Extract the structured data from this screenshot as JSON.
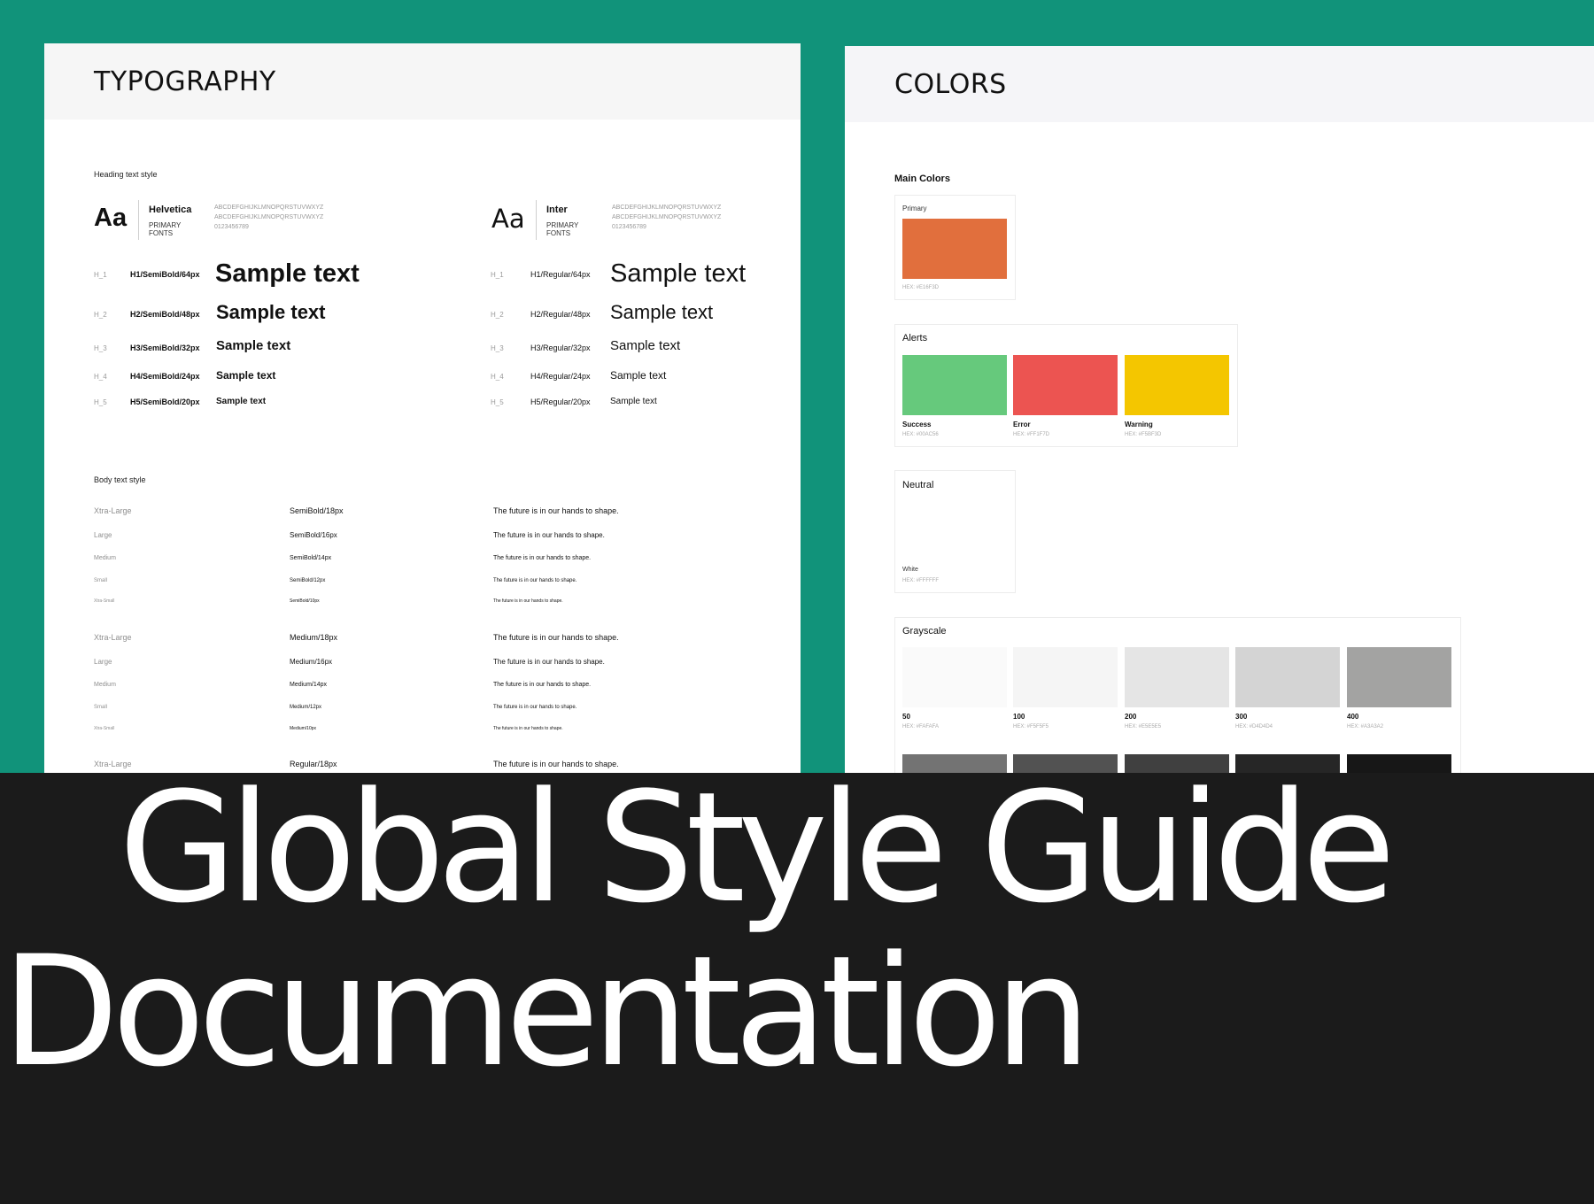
{
  "typography": {
    "title": "TYPOGRAPHY",
    "heading_label": "Heading text style",
    "font_left": {
      "aa": "Aa",
      "name": "Helvetica",
      "role": "PRIMARY FONTS",
      "alpha1": "ABCDEFGHIJKLMNOPQRSTUVWXYZ",
      "alpha2": "ABCDEFGHIJKLMNOPQRSTUVWXYZ",
      "digits": "0123456789"
    },
    "font_right": {
      "aa": "Aa",
      "name": "Inter",
      "role": "PRIMARY FONTS",
      "alpha1": "ABCDEFGHIJKLMNOPQRSTUVWXYZ",
      "alpha2": "ABCDEFGHIJKLMNOPQRSTUVWXYZ",
      "digits": "0123456789"
    },
    "headings_left": [
      {
        "level": "H_1",
        "spec": "H1/SemiBold/64px",
        "sample": "Sample text"
      },
      {
        "level": "H_2",
        "spec": "H2/SemiBold/48px",
        "sample": "Sample text"
      },
      {
        "level": "H_3",
        "spec": "H3/SemiBold/32px",
        "sample": "Sample text"
      },
      {
        "level": "H_4",
        "spec": "H4/SemiBold/24px",
        "sample": "Sample text"
      },
      {
        "level": "H_5",
        "spec": "H5/SemiBold/20px",
        "sample": "Sample text"
      }
    ],
    "headings_right": [
      {
        "level": "H_1",
        "spec": "H1/Regular/64px",
        "sample": "Sample text"
      },
      {
        "level": "H_2",
        "spec": "H2/Regular/48px",
        "sample": "Sample text"
      },
      {
        "level": "H_3",
        "spec": "H3/Regular/32px",
        "sample": "Sample text"
      },
      {
        "level": "H_4",
        "spec": "H4/Regular/24px",
        "sample": "Sample text"
      },
      {
        "level": "H_5",
        "spec": "H5/Regular/20px",
        "sample": "Sample text"
      }
    ],
    "body_label": "Body text style",
    "body_rows": [
      {
        "label": "Xtra-Large",
        "spec": "SemiBold/18px",
        "text": "The future is in our hands to shape."
      },
      {
        "label": "Large",
        "spec": "SemiBold/16px",
        "text": "The future is in our hands to shape."
      },
      {
        "label": "Medium",
        "spec": "SemiBold/14px",
        "text": "The future is in our hands to shape."
      },
      {
        "label": "Small",
        "spec": "SemiBold/12px",
        "text": "The future is in our hands to shape."
      },
      {
        "label": "Xtra-Small",
        "spec": "SemiBold/10px",
        "text": "The future is in our hands to shape."
      },
      {
        "label": "Xtra-Large",
        "spec": "Medium/18px",
        "text": "The future is in our hands to shape."
      },
      {
        "label": "Large",
        "spec": "Medium/16px",
        "text": "The future is in our hands to shape."
      },
      {
        "label": "Medium",
        "spec": "Medium/14px",
        "text": "The future is in our hands to shape."
      },
      {
        "label": "Small",
        "spec": "Medium/12px",
        "text": "The future is in our hands to shape."
      },
      {
        "label": "Xtra-Small",
        "spec": "Medium/10px",
        "text": "The future is in our hands to shape."
      },
      {
        "label": "Xtra-Large",
        "spec": "Regular/18px",
        "text": "The future is in our hands to shape."
      }
    ]
  },
  "colors": {
    "title": "COLORS",
    "main_label": "Main Colors",
    "primary": {
      "name": "Primary",
      "hex_label": "HEX: #E16F3D",
      "color": "#E16F3D"
    },
    "alerts": {
      "title": "Alerts",
      "items": [
        {
          "name": "Success",
          "hex_label": "HEX: #00AC56",
          "color": "#66C97C"
        },
        {
          "name": "Error",
          "hex_label": "HEX: #FF1F7D",
          "color": "#EC5451"
        },
        {
          "name": "Warning",
          "hex_label": "HEX: #F5BF3D",
          "color": "#F4C600"
        }
      ]
    },
    "neutral": {
      "title": "Neutral",
      "name": "White",
      "hex_label": "HEX: #FFFFFF",
      "color": "#FFFFFF"
    },
    "grayscale": {
      "title": "Grayscale",
      "items": [
        {
          "name": "50",
          "hex_label": "HEX: #FAFAFA",
          "color": "#FAFAFA"
        },
        {
          "name": "100",
          "hex_label": "HEX: #F5F5F5",
          "color": "#F5F5F5"
        },
        {
          "name": "200",
          "hex_label": "HEX: #E5E5E5",
          "color": "#E5E5E5"
        },
        {
          "name": "300",
          "hex_label": "HEX: #D4D4D4",
          "color": "#D4D4D4"
        },
        {
          "name": "400",
          "hex_label": "HEX: #A3A3A2",
          "color": "#A3A3A2"
        }
      ],
      "row2_colors": [
        "#737373",
        "#525252",
        "#404040",
        "#262626",
        "#171717"
      ]
    }
  },
  "banner": {
    "line1": "Global Style Guide",
    "line2": "Documentation"
  },
  "theme": {
    "background": "#11937A",
    "banner": "#1B1B1B"
  }
}
